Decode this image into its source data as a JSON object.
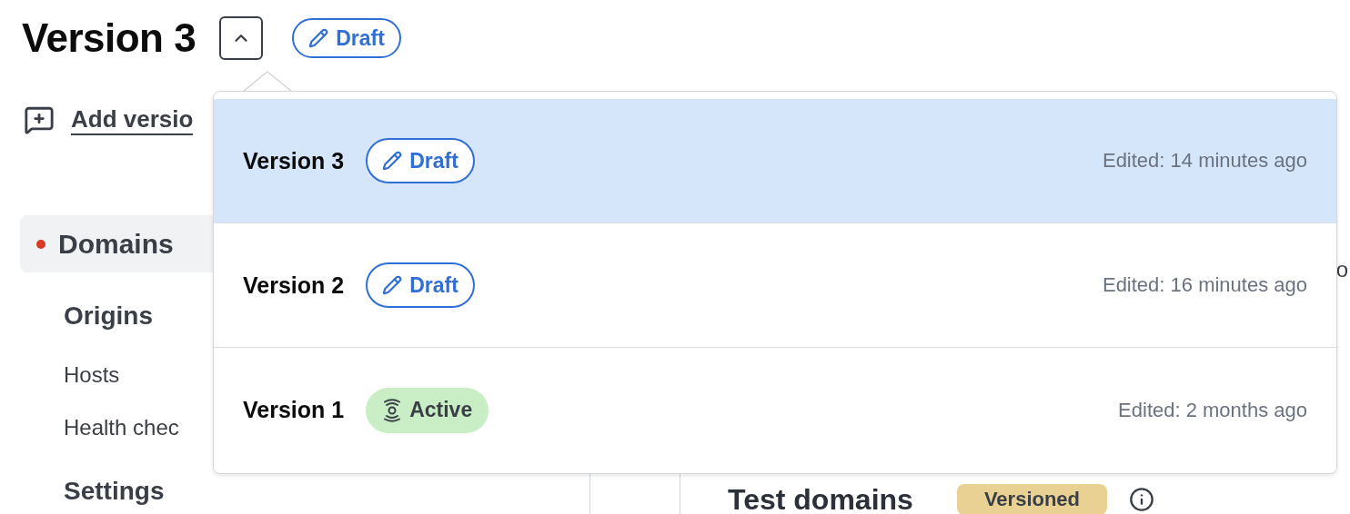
{
  "header": {
    "title": "Version 3",
    "menu_toggle": {
      "expanded": true
    },
    "status": {
      "kind": "draft",
      "label": "Draft"
    }
  },
  "add_version_link": "Add versio",
  "sidebar": {
    "items": [
      {
        "label": "Domains",
        "kind": "heading",
        "selected": true
      },
      {
        "label": "Origins",
        "kind": "heading",
        "selected": false
      },
      {
        "label": "Hosts",
        "kind": "link",
        "selected": false
      },
      {
        "label": "Health chec",
        "kind": "link",
        "selected": false
      },
      {
        "label": "Settings",
        "kind": "heading",
        "selected": false
      }
    ]
  },
  "main": {
    "fragment": "o",
    "title": "Test domains",
    "badge": "Versioned"
  },
  "versions_menu": {
    "items": [
      {
        "name": "Version 3",
        "status": {
          "kind": "draft",
          "label": "Draft"
        },
        "edited": "Edited: 14 minutes ago",
        "selected": true
      },
      {
        "name": "Version 2",
        "status": {
          "kind": "draft",
          "label": "Draft"
        },
        "edited": "Edited: 16 minutes ago",
        "selected": false
      },
      {
        "name": "Version 1",
        "status": {
          "kind": "active",
          "label": "Active"
        },
        "edited": "Edited: 2 months ago",
        "selected": false
      }
    ]
  }
}
